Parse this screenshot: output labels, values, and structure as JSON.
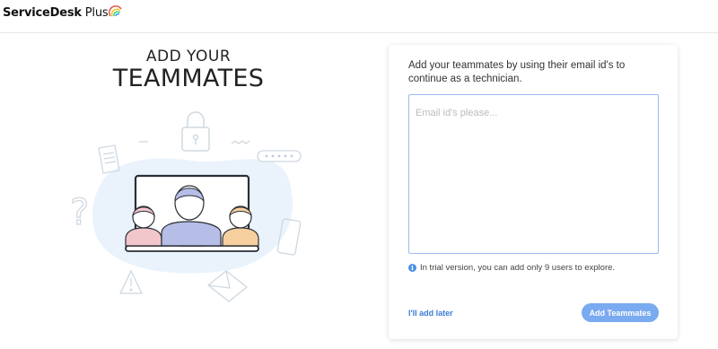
{
  "brand": {
    "name_main": "ServiceDesk",
    "name_suffix": " Plus",
    "logo_icon": "rainbow-arc-icon"
  },
  "hero": {
    "heading_small": "ADD YOUR",
    "heading_big": "TEAMMATES",
    "illustration_icon": "teammates-illustration"
  },
  "invite_card": {
    "description": "Add your teammates by using their email id's to continue as a technician.",
    "email_placeholder": "Email id's please...",
    "email_value": "",
    "info_icon": "info-icon",
    "info_text": "In trial version, you can add only 9 users to explore.",
    "later_label": "I'll add later",
    "submit_label": "Add Teammates"
  },
  "colors": {
    "accent": "#4a90e2",
    "button_bg": "#7aaaf0",
    "input_border": "#9cbcf0",
    "link": "#3b7bd8"
  }
}
